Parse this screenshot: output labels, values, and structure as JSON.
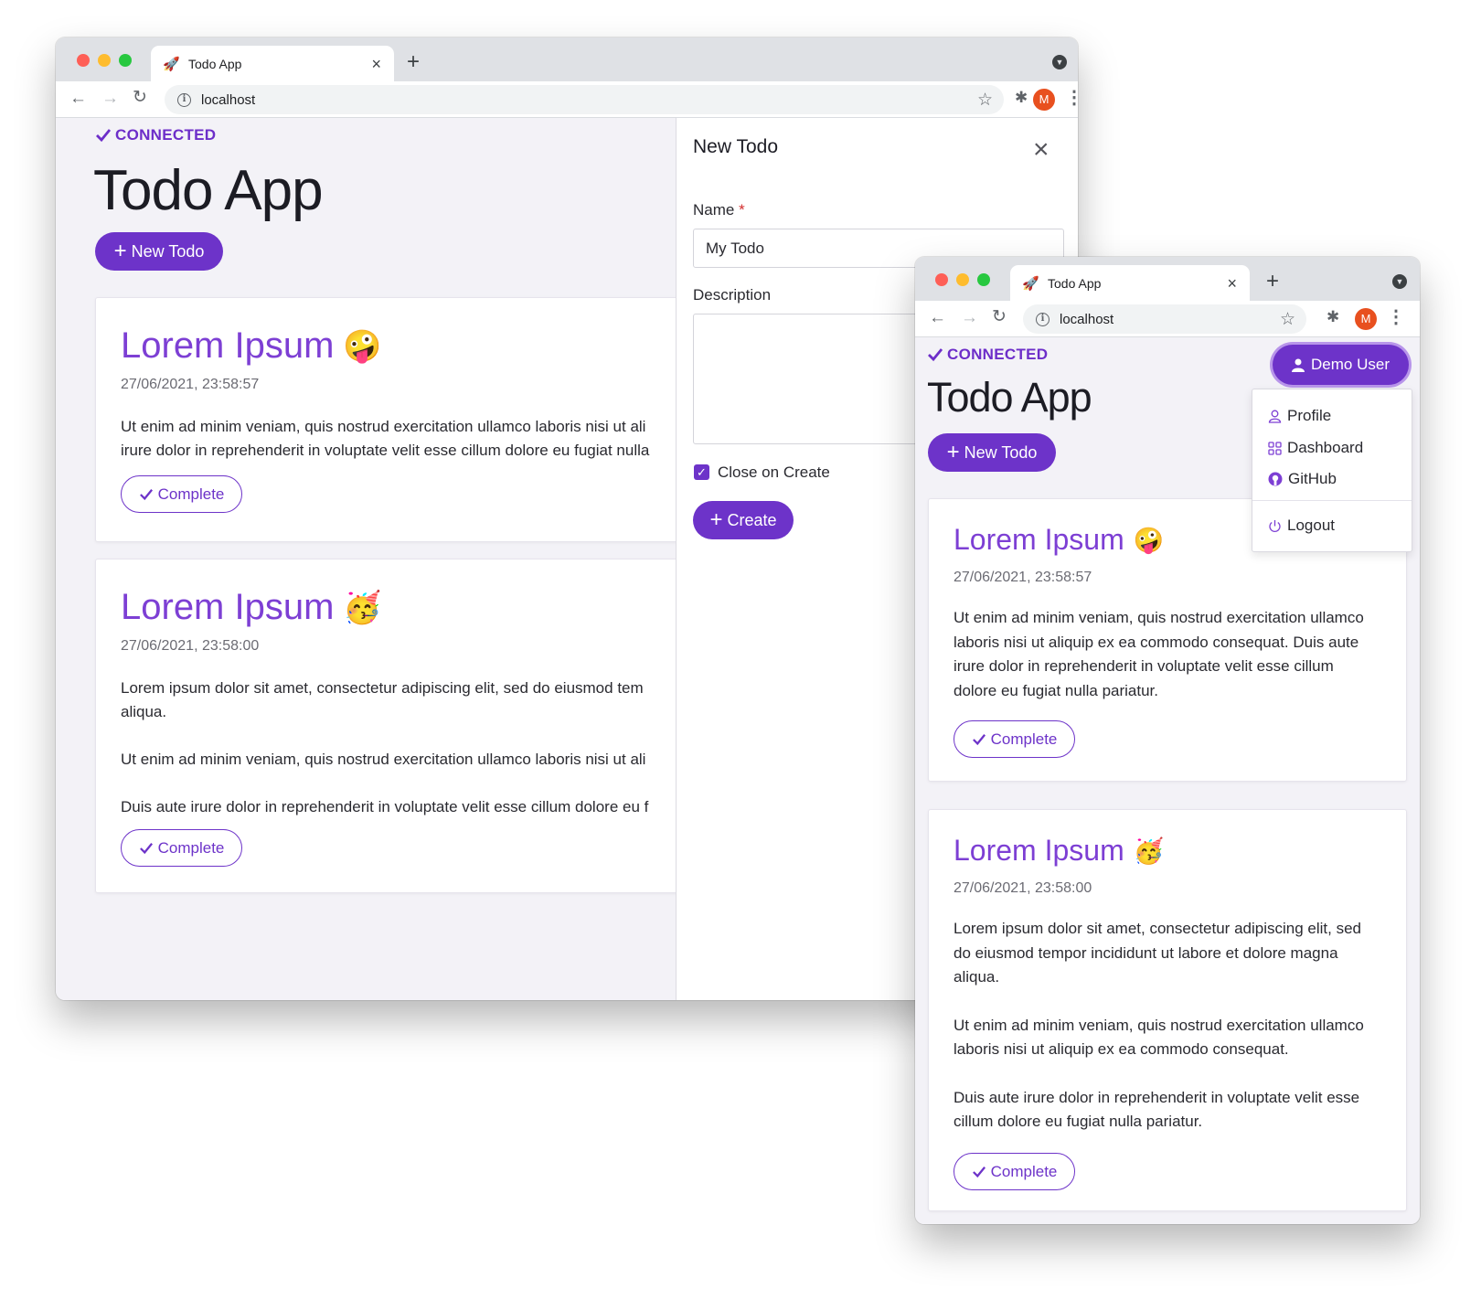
{
  "browser": {
    "tab_title": "Todo App",
    "favicon": "rocket-icon",
    "url": "localhost",
    "profile_initial": "M",
    "new_tab": "+",
    "tab_close": "×",
    "info_glyph": "i"
  },
  "app": {
    "connected": "CONNECTED",
    "title": "Todo App",
    "new_todo_label": "New Todo",
    "accent_color": "#6d33c9"
  },
  "todos": [
    {
      "title": "Lorem Ipsum",
      "emoji": "🤪",
      "date": "27/06/2021, 23:58:57",
      "paragraphs": [
        "Ut enim ad minim veniam, quis nostrud exercitation ullamco laboris nisi ut aliquip ex ea commodo consequat. Duis aute irure dolor in reprehenderit in voluptate velit esse cillum dolore eu fugiat nulla pariatur."
      ],
      "complete_label": "Complete"
    },
    {
      "title": "Lorem Ipsum",
      "emoji": "🥳",
      "date": "27/06/2021, 23:58:00",
      "paragraphs": [
        "Lorem ipsum dolor sit amet, consectetur adipiscing elit, sed do eiusmod tempor incididunt ut labore et dolore magna aliqua.",
        "Ut enim ad minim veniam, quis nostrud exercitation ullamco laboris nisi ut aliquip ex ea commodo consequat.",
        "Duis aute irure dolor in reprehenderit in voluptate velit esse cillum dolore eu fugiat nulla pariatur."
      ],
      "complete_label": "Complete"
    }
  ],
  "left_window_text": {
    "card1_line1": "Ut enim ad minim veniam, quis nostrud exercitation ullamco laboris nisi ut ali",
    "card1_line2": "irure dolor in reprehenderit in voluptate velit esse cillum dolore eu fugiat nulla",
    "card2_p1_line1": "Lorem ipsum dolor sit amet, consectetur adipiscing elit, sed do eiusmod tem",
    "card2_p1_line2": "aliqua.",
    "card2_p2": "Ut enim ad minim veniam, quis nostrud exercitation ullamco laboris nisi ut ali",
    "card2_p3": "Duis aute irure dolor in reprehenderit in voluptate velit esse cillum dolore eu f"
  },
  "drawer": {
    "title": "New Todo",
    "close_glyph": "×",
    "name_label": "Name",
    "required_mark": "*",
    "name_value": "My Todo",
    "description_label": "Description",
    "description_value": "",
    "close_on_create_label": "Close on Create",
    "close_on_create_checked": true,
    "create_label": "Create"
  },
  "user_menu": {
    "user_label": "Demo User",
    "items": [
      {
        "label": "Profile",
        "icon": "user-icon"
      },
      {
        "label": "Dashboard",
        "icon": "grid-icon"
      },
      {
        "label": "GitHub",
        "icon": "github-icon"
      },
      {
        "label": "Logout",
        "icon": "power-icon"
      }
    ]
  }
}
